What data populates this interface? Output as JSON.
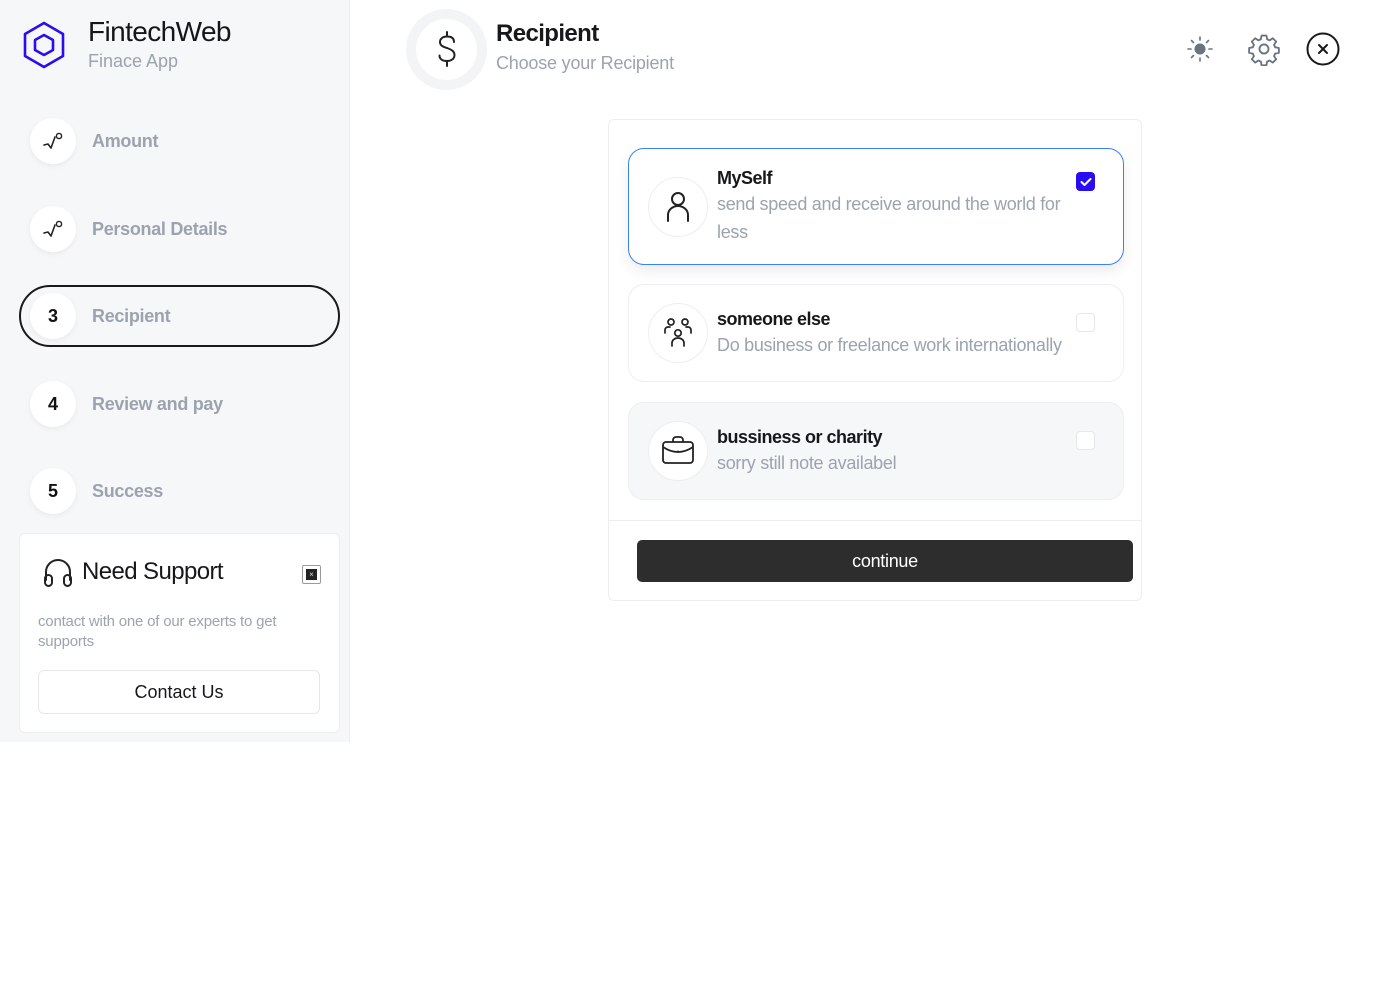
{
  "brand": {
    "title": "FintechWeb",
    "subtitle": "Finace App",
    "accent_color": "#2a0cf0"
  },
  "steps": [
    {
      "marker": "√°",
      "label": "Amount",
      "state": "completed"
    },
    {
      "marker": "√°",
      "label": "Personal Details",
      "state": "completed"
    },
    {
      "marker": "3",
      "label": "Recipient",
      "state": "active"
    },
    {
      "marker": "4",
      "label": "Review and pay",
      "state": "pending"
    },
    {
      "marker": "5",
      "label": "Success",
      "state": "pending"
    }
  ],
  "support": {
    "title": "Need Support",
    "description": "contact with one of our experts to get supports",
    "button_label": "Contact Us",
    "close_symbol": "×"
  },
  "header": {
    "icon": "dollar-icon",
    "title": "Recipient",
    "subtitle": "Choose your Recipient"
  },
  "top_actions": [
    {
      "icon": "sun-icon",
      "label": "theme toggle"
    },
    {
      "icon": "gear-icon",
      "label": "settings"
    },
    {
      "icon": "close-circle-icon",
      "label": "close"
    }
  ],
  "options": [
    {
      "icon": "user-icon",
      "title": "MySelf",
      "description": "send speed and receive around the world for less",
      "checked": true,
      "disabled": false
    },
    {
      "icon": "users-group-icon",
      "title": "someone else",
      "description": "Do business or freelance work internationally",
      "checked": false,
      "disabled": false
    },
    {
      "icon": "briefcase-icon",
      "title": "bussiness or charity",
      "description": "sorry still note availabel",
      "checked": false,
      "disabled": true
    }
  ],
  "continue_label": "continue"
}
